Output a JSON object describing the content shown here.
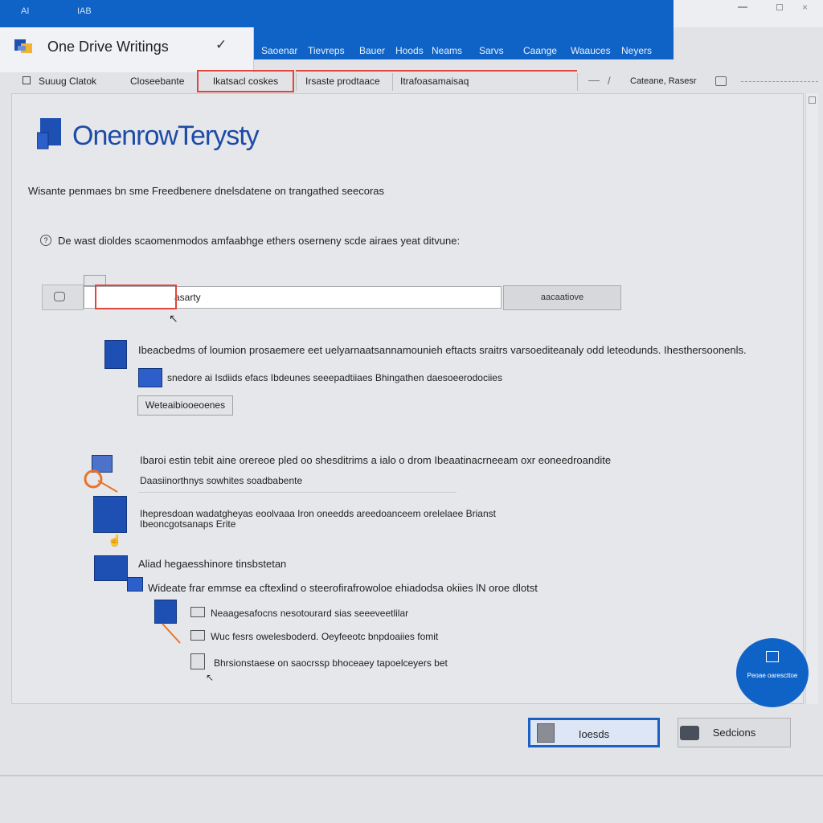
{
  "window": {
    "title": "One Drive Writings",
    "controls": [
      "AI",
      "IAB"
    ],
    "menu": [
      "Saoenar",
      "Tievreps",
      "Bauer",
      "Hoods",
      "Neams",
      "Sarvs",
      "Caange",
      "Waauces",
      "Neyers"
    ]
  },
  "ribbon": {
    "items": [
      "Suuug Clatok",
      "Closeebante",
      "Ikatsacl coskes",
      "Irsaste prodtaace",
      "Itrafoasamaisaq"
    ],
    "right_label": "Cateane, Rasesr"
  },
  "content": {
    "brand": "OnenrowTerysty",
    "description": "Wisante penmaes bn sme Freedbenere dnelsdatene on trangathed seecoras",
    "question": "De wast dioldes scaomenmodos amfaabhge ethers oserneny scde airaes yeat ditvune:",
    "input": {
      "value": "asarty",
      "button": "aacaatiove"
    },
    "section1": {
      "heading": "Ibeacbedms of loumion prosaemere eet uelyarnaatsannamounieh eftacts sraitrs varsoediteanaly odd leteodunds. Ihesthersoonenls.",
      "line": "snedore ai Isdiids efacs Ibdeunes seeepadtiiaes Bhingathen daesoeerodociies",
      "button": "Weteaibiooeoenes"
    },
    "section2": {
      "line1": "Ibaroi estin tebit aine orereoe pled oo shesditrims a ialo o drom Ibeaatinacrneeam oxr eoneedroandite",
      "line2": "Daasiinorthnys sowhites soadbabente"
    },
    "section3": {
      "line1": "Ihepresdoan wadatgheyas eoolvaaa Iron oneedds areedoanceem orelelaee Brianst",
      "line2": "Ibeoncgotsanaps Erite"
    },
    "section4": {
      "heading": "Aliad hegaesshinore tinsbstetan",
      "line": "Wideate frar emmse ea cftexlind o steerofirafrowoloe ehiadodsa okiies lN oroe dlotst",
      "sub": [
        "Neaagesafocns nesotourard sias seeeveetlilar",
        "Wuc fesrs owelesboderd. Oeyfeeotc bnpdoaiies fomit",
        "Bhrsionstaese on saocrssp bhoceaey tapoelceyers bet"
      ]
    },
    "fab_label": "Peoae oarescttoe"
  },
  "footer": {
    "primary": "Ioesds",
    "secondary": "Sedcions"
  },
  "colors": {
    "accent": "#0f63c6",
    "icon_blue": "#1e4fb3",
    "highlight": "#e0463b",
    "arrow": "#e8742c"
  }
}
